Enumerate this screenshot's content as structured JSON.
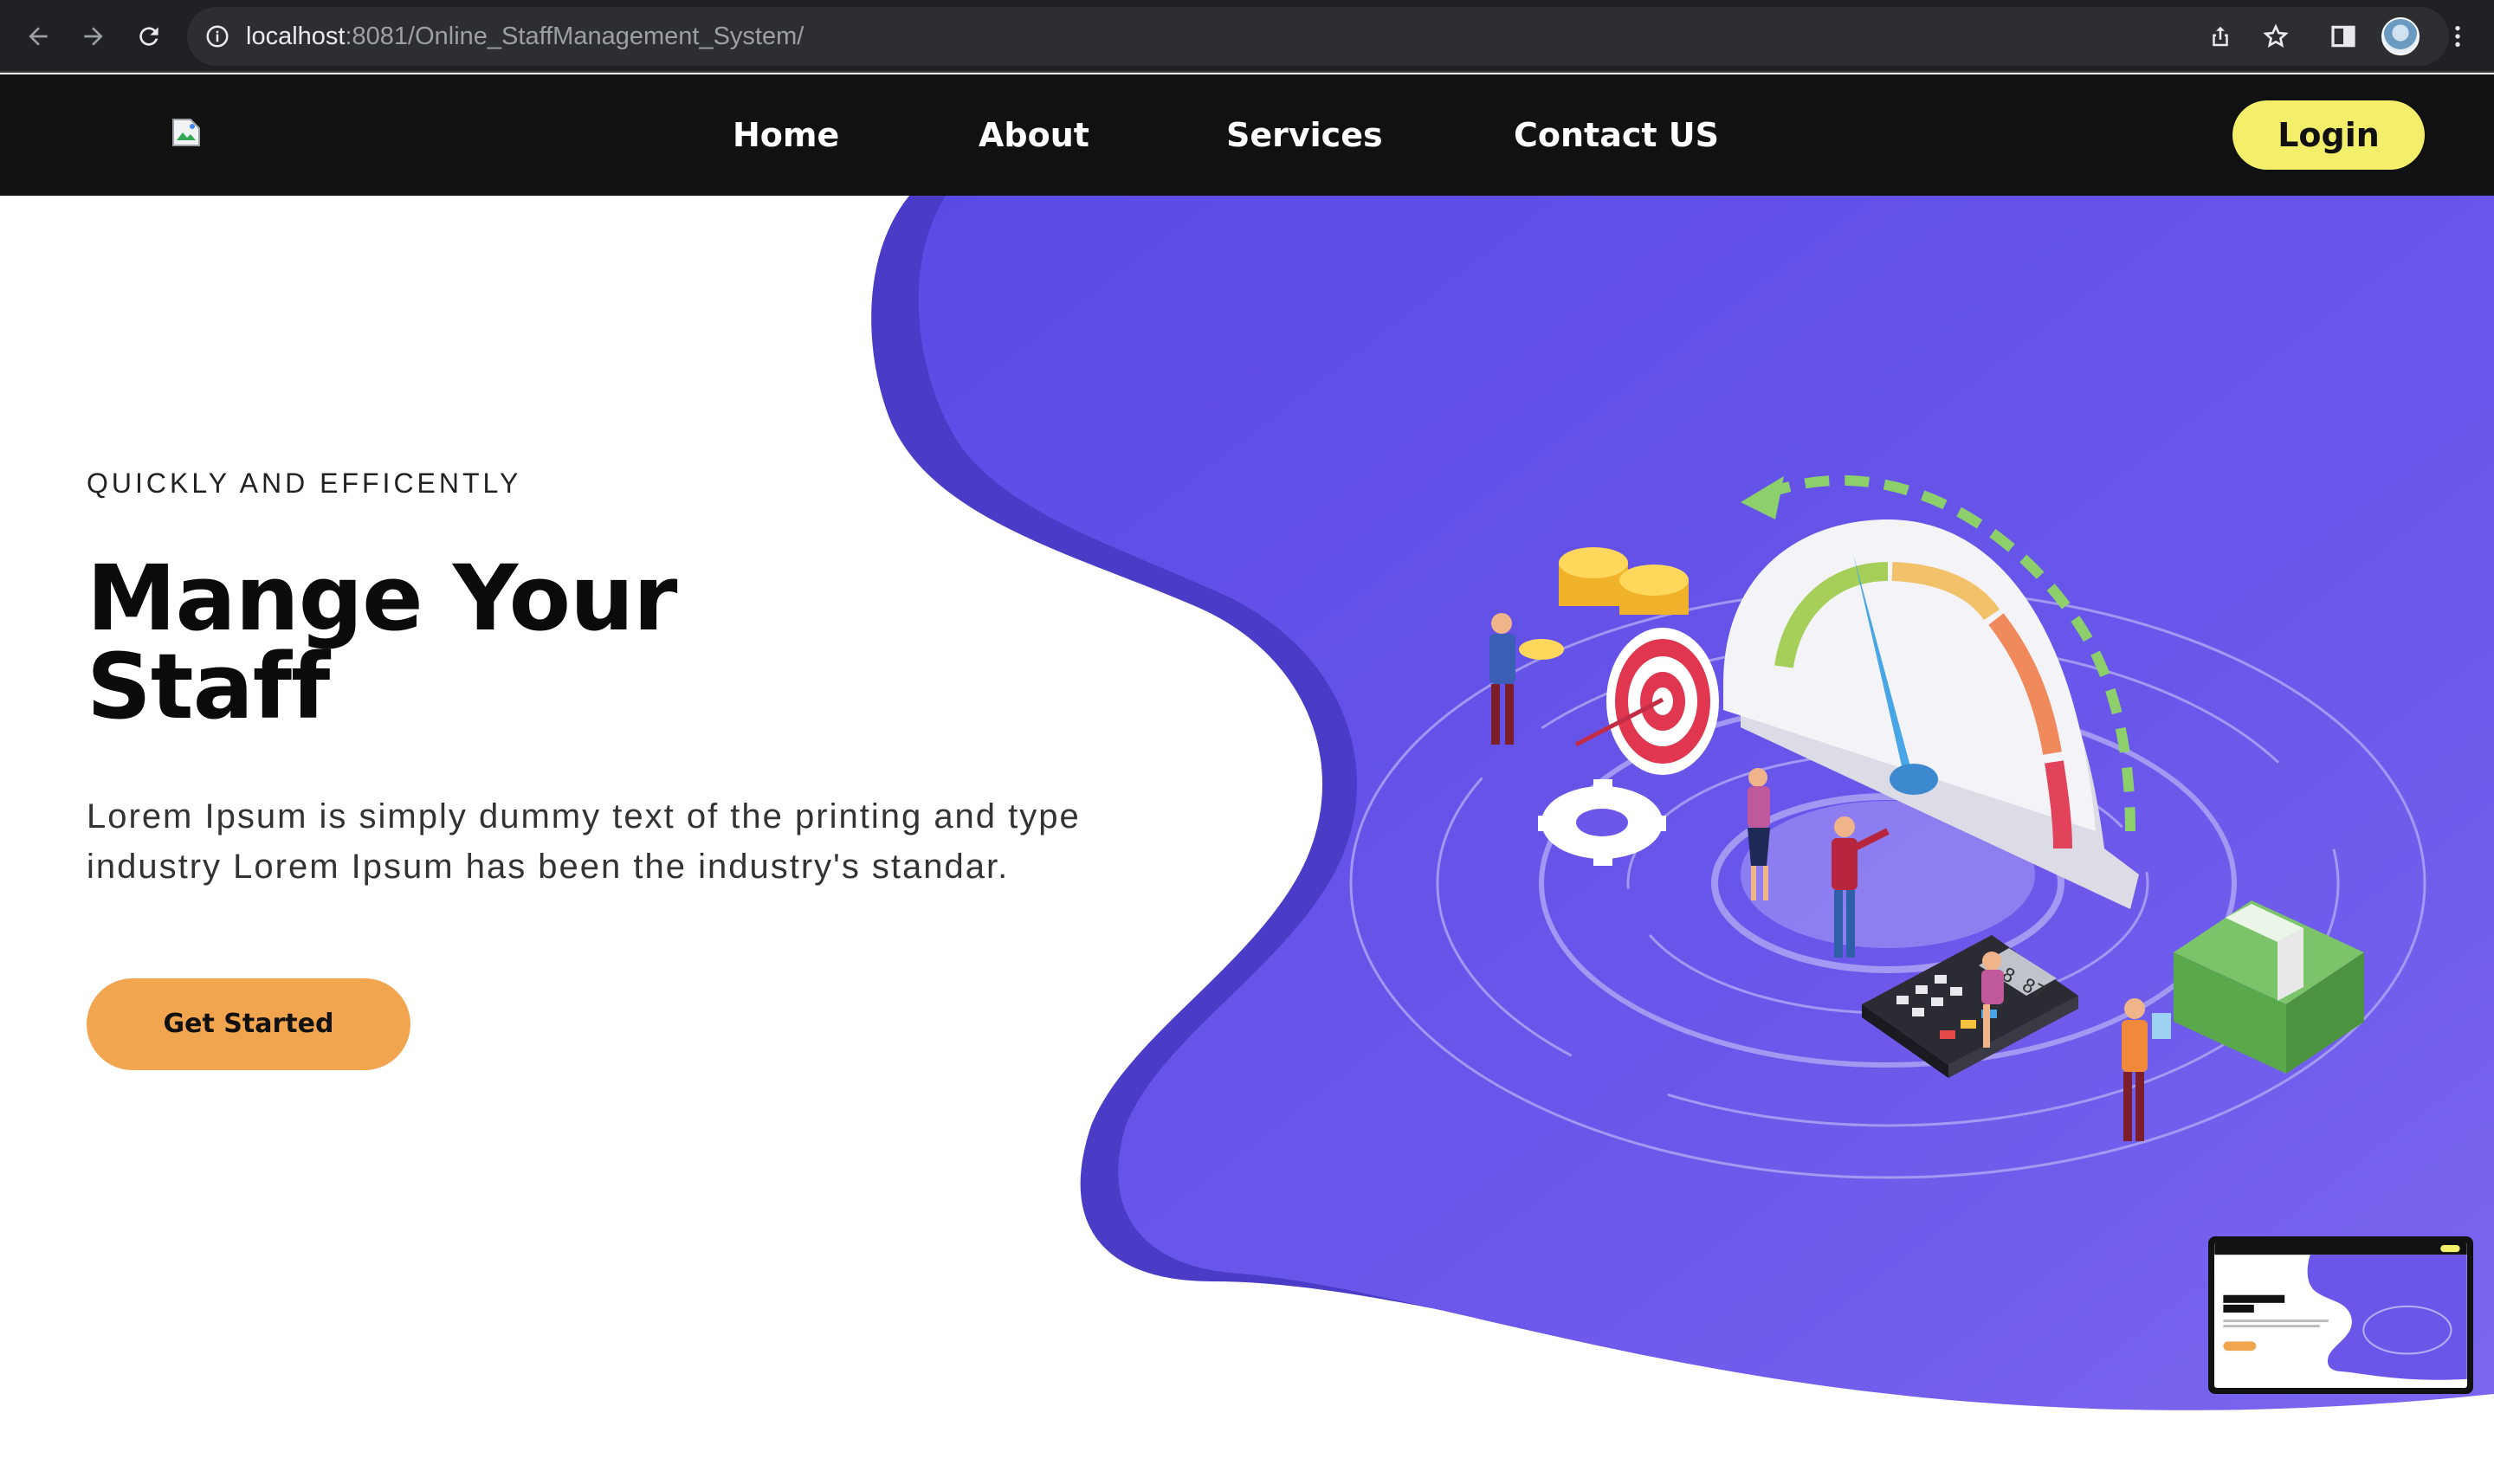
{
  "browser": {
    "url_host": "localhost",
    "url_rest": ":8081/Online_StaffManagement_System/"
  },
  "header": {
    "nav": [
      "Home",
      "About",
      "Services",
      "Contact US"
    ],
    "login_label": "Login"
  },
  "hero": {
    "eyebrow": "QUICKLY AND EFFICENTLY",
    "title_line1": "Mange Your",
    "title_line2": "Staff",
    "description": "Lorem Ipsum is simply dummy text of the printing and type industry Lorem Ipsum has been the industry's standar.",
    "cta_label": "Get Started"
  },
  "illustration": {
    "calculator_display": "8 87"
  },
  "colors": {
    "header_bg": "#111111",
    "login_bg": "#f3ef6a",
    "cta_bg": "#f2a54f",
    "hero_purple": "#5e4de4",
    "hero_purple_dark": "#4a3cc7"
  }
}
